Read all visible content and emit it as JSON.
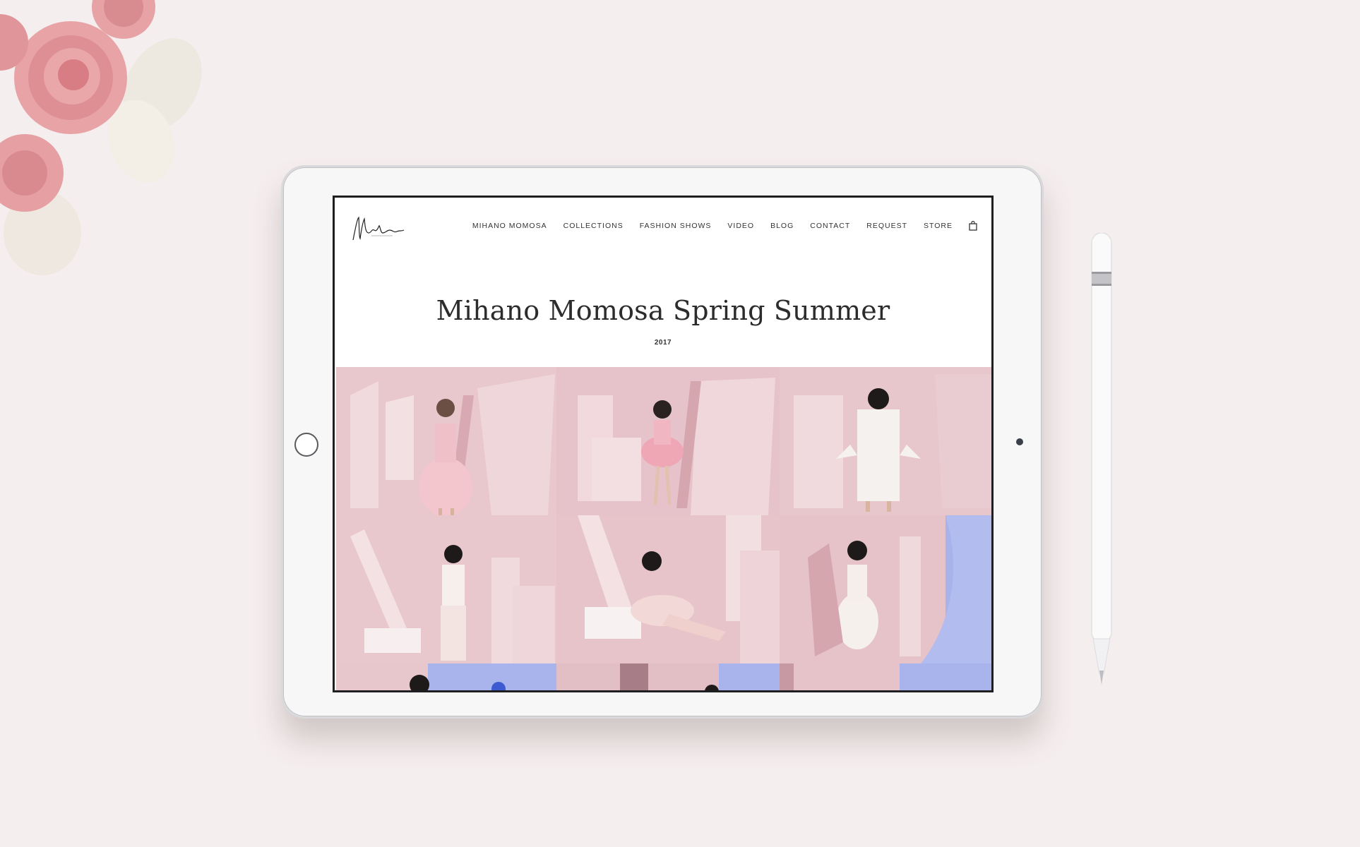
{
  "site": {
    "logo_alt": "Mihano Momosa signature logo",
    "nav": [
      {
        "label": "MIHANO MOMOSA"
      },
      {
        "label": "COLLECTIONS"
      },
      {
        "label": "FASHION SHOWS"
      },
      {
        "label": "VIDEO"
      },
      {
        "label": "BLOG"
      },
      {
        "label": "CONTACT"
      },
      {
        "label": "REQUEST"
      },
      {
        "label": "STORE"
      }
    ],
    "cart_icon": "shopping-bag-icon"
  },
  "page": {
    "title": "Mihano Momosa Spring Summer",
    "year": "2017"
  },
  "gallery": {
    "photo_count_visible": 9,
    "colors": {
      "backdrop_pink": "#e9c9cf",
      "accent_blue": "#a9b4ec"
    }
  },
  "colors": {
    "background": "#f5eeee",
    "text": "#2c2c2c"
  }
}
